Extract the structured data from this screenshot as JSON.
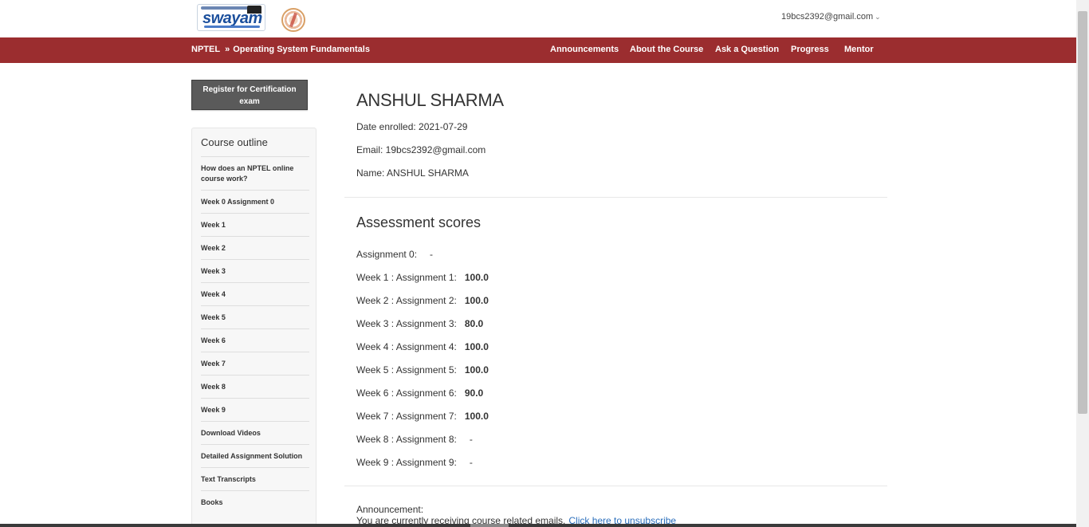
{
  "header": {
    "user_email": "19bcs2392@gmail.com",
    "user_chevron": "⌄",
    "logo_swayam_text": "swayam"
  },
  "navbar": {
    "crumb_root": "NPTEL",
    "crumb_sep": "»",
    "course_title": "Operating System Fundamentals",
    "links": [
      "Announcements",
      "About the Course",
      "Ask a Question",
      "Progress",
      "Mentor"
    ]
  },
  "sidebar": {
    "cert_button": "Register for Certification exam",
    "outline_title": "Course outline",
    "items": [
      "How does an NPTEL online course work?",
      "Week 0 Assignment 0",
      "Week 1",
      "Week 2",
      "Week 3",
      "Week 4",
      "Week 5",
      "Week 6",
      "Week 7",
      "Week 8",
      "Week 9",
      "Download Videos",
      "Detailed Assignment Solution",
      "Text Transcripts",
      "Books"
    ]
  },
  "profile": {
    "name_heading": "ANSHUL SHARMA",
    "date_enrolled": "Date enrolled: 2021-07-29",
    "email": "Email: 19bcs2392@gmail.com",
    "name": "Name: ANSHUL SHARMA"
  },
  "assessment": {
    "title": "Assessment scores",
    "rows": [
      {
        "label": "Assignment 0:",
        "value": "-"
      },
      {
        "label": "Week 1 : Assignment 1:",
        "value": "100.0"
      },
      {
        "label": "Week 2 : Assignment 2:",
        "value": "100.0"
      },
      {
        "label": "Week 3 : Assignment 3:",
        "value": "80.0"
      },
      {
        "label": "Week 4 : Assignment 4:",
        "value": "100.0"
      },
      {
        "label": "Week 5 : Assignment 5:",
        "value": "100.0"
      },
      {
        "label": "Week 6 : Assignment 6:",
        "value": "90.0"
      },
      {
        "label": "Week 7 : Assignment 7:",
        "value": "100.0"
      },
      {
        "label": "Week 8 : Assignment 8:",
        "value": "-"
      },
      {
        "label": "Week 9 : Assignment 9:",
        "value": "-"
      }
    ]
  },
  "announcement": {
    "title": "Announcement:",
    "text": "You are currently receiving course related emails.",
    "link": "Click here to unsubscribe"
  },
  "colors": {
    "navbar_bg": "#9b2d2f",
    "cert_button_bg": "#5a5a5a",
    "link": "#2a6ebb"
  }
}
